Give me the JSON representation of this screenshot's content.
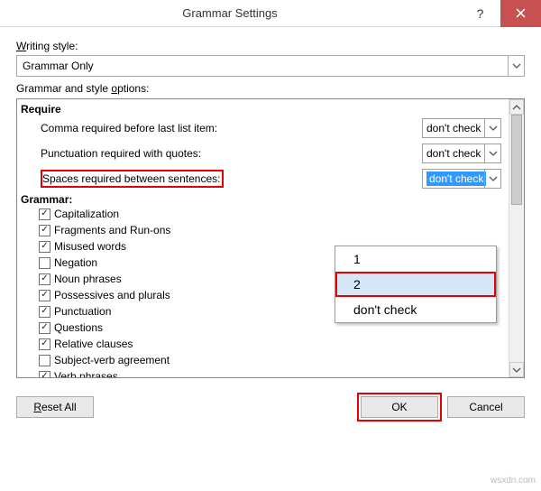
{
  "title": "Grammar Settings",
  "writingStyle": {
    "label": "Writing style:",
    "underline": "W",
    "value": "Grammar Only"
  },
  "optionsLabel": {
    "pre": "Grammar and style ",
    "u": "o",
    "post": "ptions:"
  },
  "require": {
    "heading": "Require",
    "rows": [
      {
        "label": "Comma required before last list item:",
        "value": "don't check",
        "selected": false,
        "highlight": false
      },
      {
        "label": "Punctuation required with quotes:",
        "value": "don't check",
        "selected": false,
        "highlight": false
      },
      {
        "label": "Spaces required between sentences:",
        "value": "don't check",
        "selected": true,
        "highlight": true
      }
    ]
  },
  "dropdownOptions": [
    "1",
    "2",
    "don't check"
  ],
  "dropdownHighlightIndex": 1,
  "grammar": {
    "heading": "Grammar:",
    "items": [
      {
        "label": "Capitalization",
        "checked": true
      },
      {
        "label": "Fragments and Run-ons",
        "checked": true
      },
      {
        "label": "Misused words",
        "checked": true
      },
      {
        "label": "Negation",
        "checked": false
      },
      {
        "label": "Noun phrases",
        "checked": true
      },
      {
        "label": "Possessives and plurals",
        "checked": true
      },
      {
        "label": "Punctuation",
        "checked": true
      },
      {
        "label": "Questions",
        "checked": true
      },
      {
        "label": "Relative clauses",
        "checked": true
      },
      {
        "label": "Subject-verb agreement",
        "checked": false
      },
      {
        "label": "Verb phrases",
        "checked": true
      }
    ]
  },
  "buttons": {
    "reset": "Reset All",
    "resetU": "R",
    "ok": "OK",
    "cancel": "Cancel"
  },
  "watermark": "wsxdn.com"
}
